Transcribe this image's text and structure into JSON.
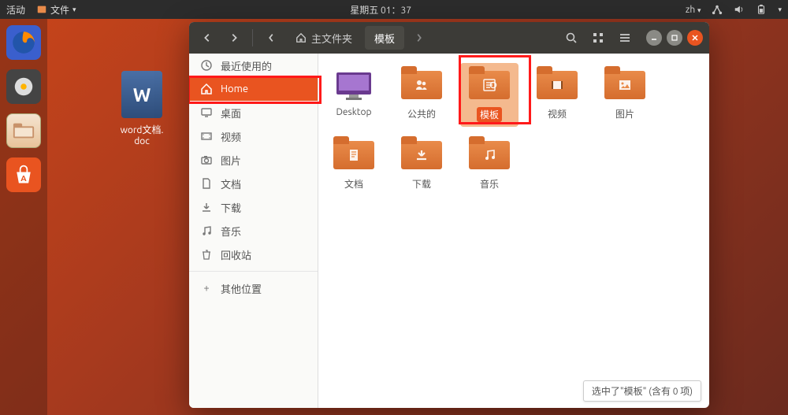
{
  "topbar": {
    "activities": "活动",
    "app_menu": "文件",
    "clock": "星期五 01：37",
    "input_method": "zh"
  },
  "desktop": {
    "file_label": "word文档.\ndoc",
    "doc_letter": "W"
  },
  "fm": {
    "path": {
      "home_label": "主文件夹",
      "current": "模板"
    },
    "sidebar": [
      {
        "id": "recent",
        "icon": "clock",
        "label": "最近使用的"
      },
      {
        "id": "home",
        "icon": "home",
        "label": "Home",
        "active": true
      },
      {
        "id": "desktop",
        "icon": "desktop",
        "label": "桌面"
      },
      {
        "id": "videos",
        "icon": "video",
        "label": "视频"
      },
      {
        "id": "pictures",
        "icon": "camera",
        "label": "图片"
      },
      {
        "id": "documents",
        "icon": "doc",
        "label": "文档"
      },
      {
        "id": "downloads",
        "icon": "down",
        "label": "下载"
      },
      {
        "id": "music",
        "icon": "music",
        "label": "音乐"
      },
      {
        "id": "trash",
        "icon": "trash",
        "label": "回收站"
      }
    ],
    "sidebar_other": {
      "icon": "plus",
      "label": "其他位置"
    },
    "folders_row1": [
      {
        "id": "desktop-folder",
        "label": "Desktop",
        "overlay": "desktop"
      },
      {
        "id": "public-folder",
        "label": "公共的",
        "overlay": "people"
      },
      {
        "id": "templates-folder",
        "label": "模板",
        "overlay": "templates",
        "selected": true
      },
      {
        "id": "videos-folder",
        "label": "视频",
        "overlay": "video"
      },
      {
        "id": "pictures-folder",
        "label": "图片",
        "overlay": "picture"
      }
    ],
    "folders_row2": [
      {
        "id": "documents-folder",
        "label": "文档",
        "overlay": "doc"
      },
      {
        "id": "downloads-folder",
        "label": "下载",
        "overlay": "down"
      },
      {
        "id": "music-folder",
        "label": "音乐",
        "overlay": "music"
      }
    ],
    "status": "选中了\"模板\" (含有 0 项)"
  }
}
